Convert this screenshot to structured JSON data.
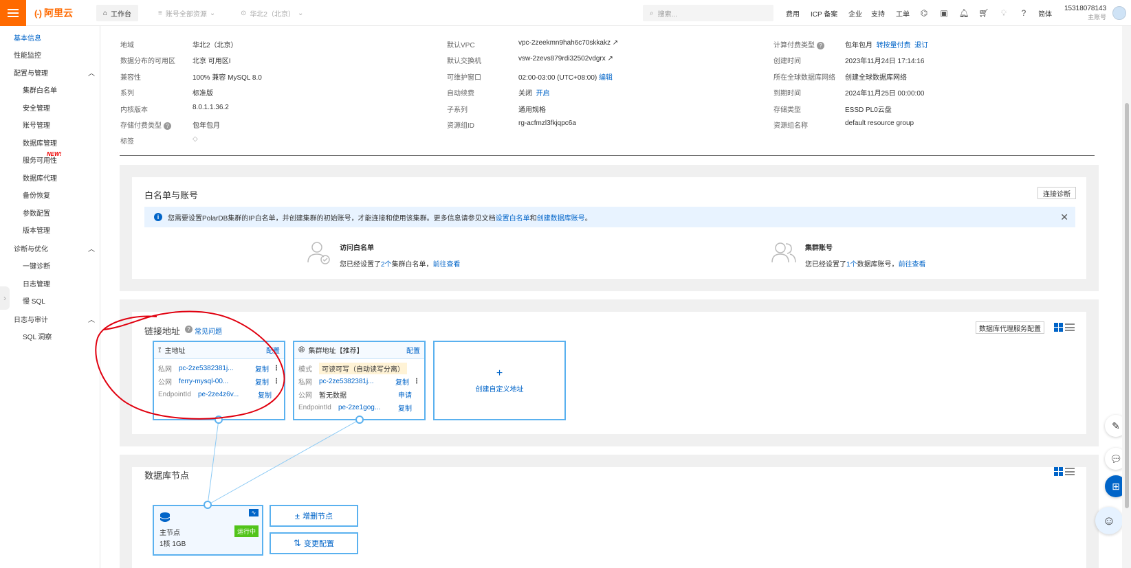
{
  "topbar": {
    "logo_mark": "(-)",
    "logo_text": "阿里云",
    "workbench": "工作台",
    "resources": "账号全部资源",
    "region": "华北2（北京）",
    "search_placeholder": "搜索...",
    "links": [
      "费用",
      "ICP 备案",
      "企业",
      "支持",
      "工单"
    ],
    "lang": "简体",
    "user_id": "15318078143",
    "user_role": "主账号"
  },
  "sidebar": {
    "basic": "基本信息",
    "perf": "性能监控",
    "group_config": "配置与管理",
    "cluster_whitelist": "集群白名单",
    "security": "安全管理",
    "account": "账号管理",
    "db_manage": "数据库管理",
    "service_avail": "服务可用性",
    "new_badge": "NEW!",
    "db_proxy": "数据库代理",
    "backup": "备份恢复",
    "params": "参数配置",
    "version": "版本管理",
    "group_diag": "诊断与优化",
    "one_click": "一键诊断",
    "log_manage": "日志管理",
    "slow_sql": "慢 SQL",
    "group_log": "日志与审计",
    "sql_insight": "SQL 洞察"
  },
  "info": {
    "region_l": "地域",
    "region_v": "华北2（北京）",
    "zone_l": "数据分布的可用区",
    "zone_v": "北京 可用区I",
    "compat_l": "兼容性",
    "compat_v": "100% 兼容 MySQL 8.0",
    "series_l": "系列",
    "series_v": "标准版",
    "kernel_l": "内核版本",
    "kernel_v": "8.0.1.1.36.2",
    "storage_pay_l": "存储付费类型",
    "storage_pay_v": "包年包月",
    "tag_l": "标签",
    "vpc_l": "默认VPC",
    "vpc_v": "vpc-2zeekmn9hah6c70skkakz",
    "vsw_l": "默认交换机",
    "vsw_v": "vsw-2zevs879rdi32502vdgrx",
    "maint_l": "可维护窗口",
    "maint_v": "02:00-03:00 (UTC+08:00)",
    "maint_edit": "编辑",
    "renew_l": "自动续费",
    "renew_v": "关闭",
    "renew_on": "开启",
    "subseries_l": "子系列",
    "subseries_v": "通用规格",
    "rg_l": "资源组ID",
    "rg_v": "rg-acfmzl3fkjqpc6a",
    "billing_l": "计算付费类型",
    "billing_v": "包年包月",
    "billing_switch": "转按量付费",
    "billing_refund": "退订",
    "created_l": "创建时间",
    "created_v": "2023年11月24日 17:14:16",
    "gdn_l": "所在全球数据库网络",
    "gdn_v": "创建全球数据库网络",
    "expire_l": "到期时间",
    "expire_v": "2024年11月25日 00:00:00",
    "storage_type_l": "存储类型",
    "storage_type_v": "ESSD PL0云盘",
    "rg_name_l": "资源组名称",
    "rg_name_v": "default resource group"
  },
  "whitelist": {
    "title": "白名单与账号",
    "diag_btn": "连接诊断",
    "alert_text": "您需要设置PolarDB集群的IP白名单，并创建集群的初始账号，才能连接和使用该集群。更多信息请参见文档",
    "alert_link1": "设置白名单",
    "alert_and": "和",
    "alert_link2": "创建数据库账号",
    "alert_end": "。",
    "access_title": "访问白名单",
    "access_desc_pre": "您已经设置了",
    "access_count": "2个",
    "access_desc_post": "集群白名单，",
    "access_link": "前往查看",
    "acct_title": "集群账号",
    "acct_desc_pre": "您已经设置了",
    "acct_count": "1个",
    "acct_desc_post": "数据库账号，",
    "acct_link": "前往查看"
  },
  "endpoints": {
    "title": "链接地址",
    "faq": "常见问题",
    "proxy_btn": "数据库代理服务配置",
    "primary": {
      "title": "主地址",
      "cfg": "配置",
      "private_k": "私网",
      "private_v": "pc-2ze5382381j...",
      "public_k": "公网",
      "public_v": "ferry-mysql-00...",
      "epid_k": "EndpointId",
      "epid_v": "pe-2ze4z6v...",
      "copy": "复制"
    },
    "cluster": {
      "title": "集群地址【推荐】",
      "cfg": "配置",
      "mode_k": "模式",
      "mode_v": "可读可写（自动读写分离）",
      "private_k": "私网",
      "private_v": "pc-2ze5382381j...",
      "public_k": "公网",
      "public_v": "暂无数据",
      "apply": "申请",
      "epid_k": "EndpointId",
      "epid_v": "pe-2ze1gog...",
      "copy": "复制"
    },
    "create": "创建自定义地址"
  },
  "nodes": {
    "title": "数据库节点",
    "node_name": "主节点",
    "node_spec": "1核 1GB",
    "node_status": "运行中",
    "add_btn": "增删节点",
    "change_btn": "变更配置"
  },
  "colors": {
    "orange": "#ff6a00",
    "blue": "#0064c8",
    "green": "#52c41a",
    "annotation_red": "#e0000f"
  }
}
